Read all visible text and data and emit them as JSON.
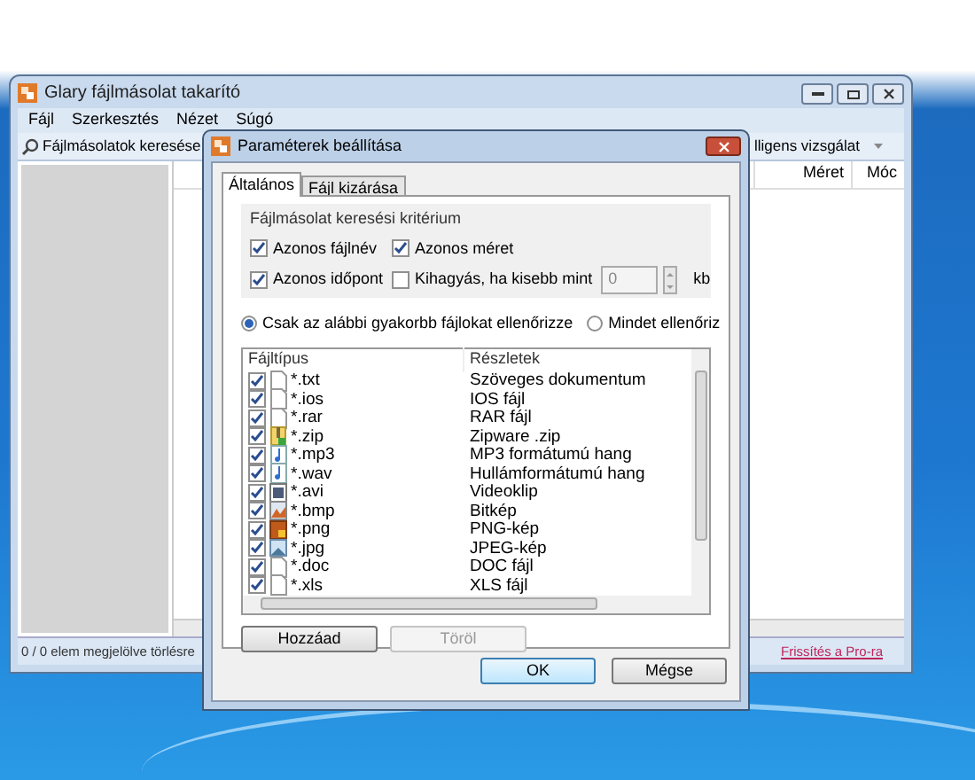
{
  "main_window": {
    "title": "Glary fájlmásolat takarító",
    "menu": [
      "Fájl",
      "Szerkesztés",
      "Nézet",
      "Súgó"
    ],
    "toolbar": [
      {
        "kind": "search",
        "label": "Fájlmásolatok keresése"
      },
      {
        "kind": "dropdown",
        "label": "lligens vizsgálat"
      }
    ],
    "columns": [
      "Méret",
      "Móc"
    ],
    "status_bar": {
      "text": "0 / 0 elem megjelölve törlésre",
      "link": "Frissítés a Pro-ra"
    }
  },
  "dialog": {
    "title": "Paraméterek beállítása",
    "tabs": [
      {
        "label": "Általános",
        "selected": true
      },
      {
        "label": "Fájl kizárása",
        "selected": false
      }
    ],
    "criteria": {
      "title": "Fájlmásolat keresési kritérium",
      "options": [
        {
          "label": "Azonos fájlnév",
          "checked": true
        },
        {
          "label": "Azonos méret",
          "checked": true
        },
        {
          "label": "Azonos időpont",
          "checked": true
        },
        {
          "label": "Kihagyás, ha kisebb mint",
          "checked": false
        }
      ],
      "min_size": {
        "value": "0",
        "unit": "kb"
      }
    },
    "scope": [
      {
        "label": "Csak az alábbi gyakorbb fájlokat ellenőrizze",
        "selected": true
      },
      {
        "label": "Mindet ellenőriz",
        "selected": false
      }
    ],
    "file_list": {
      "columns": [
        "Fájltípus",
        "Részletek"
      ],
      "rows": [
        {
          "type": "*.txt",
          "details": "Szöveges dokumentum",
          "checked": true,
          "kind": "document"
        },
        {
          "type": "*.ios",
          "details": "IOS fájl",
          "checked": true,
          "kind": "document"
        },
        {
          "type": "*.rar",
          "details": "RAR fájl",
          "checked": true,
          "kind": "document"
        },
        {
          "type": "*.zip",
          "details": "Zipware .zip",
          "checked": true,
          "kind": "archive"
        },
        {
          "type": "*.mp3",
          "details": "MP3 formátumú hang",
          "checked": true,
          "kind": "audio"
        },
        {
          "type": "*.wav",
          "details": "Hullámformátumú hang",
          "checked": true,
          "kind": "audio"
        },
        {
          "type": "*.avi",
          "details": "Videoklip",
          "checked": true,
          "kind": "video"
        },
        {
          "type": "*.bmp",
          "details": "Bitkép",
          "checked": true,
          "kind": "paint"
        },
        {
          "type": "*.png",
          "details": "PNG-kép",
          "checked": true,
          "kind": "picture"
        },
        {
          "type": "*.jpg",
          "details": "JPEG-kép",
          "checked": true,
          "kind": "photo"
        },
        {
          "type": "*.doc",
          "details": "DOC fájl",
          "checked": true,
          "kind": "document"
        },
        {
          "type": "*.xls",
          "details": "XLS fájl",
          "checked": true,
          "kind": "document"
        }
      ]
    },
    "list_buttons": [
      {
        "label": "Hozzáad",
        "disabled": false
      },
      {
        "label": "Töröl",
        "disabled": true
      }
    ],
    "footer_buttons": [
      {
        "label": "OK",
        "default": true
      },
      {
        "label": "Mégse",
        "default": false
      }
    ]
  }
}
